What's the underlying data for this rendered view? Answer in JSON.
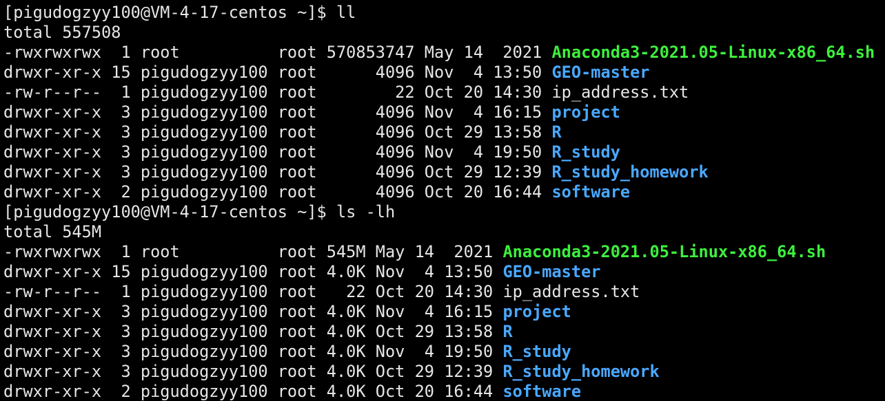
{
  "theme": {
    "background": "#000000",
    "text": "#e6e6e6",
    "executable": "#3df03d",
    "directory": "#4aa8ff"
  },
  "lines": [
    {
      "kind": "prompt",
      "prefix": "[pigudogzyy100@VM-4-17-centos ~]$ ll",
      "name": ""
    },
    {
      "kind": "output",
      "prefix": "total 557508",
      "name": ""
    },
    {
      "kind": "exec",
      "prefix": "-rwxrwxrwx  1 root          root 570853747 May 14  2021 ",
      "name": "Anaconda3-2021.05-Linux-x86_64.sh"
    },
    {
      "kind": "dir",
      "prefix": "drwxr-xr-x 15 pigudogzyy100 root      4096 Nov  4 13:50 ",
      "name": "GEO-master"
    },
    {
      "kind": "file",
      "prefix": "-rw-r--r--  1 pigudogzyy100 root        22 Oct 20 14:30 ",
      "name": "ip_address.txt"
    },
    {
      "kind": "dir",
      "prefix": "drwxr-xr-x  3 pigudogzyy100 root      4096 Nov  4 16:15 ",
      "name": "project"
    },
    {
      "kind": "dir",
      "prefix": "drwxr-xr-x  3 pigudogzyy100 root      4096 Oct 29 13:58 ",
      "name": "R"
    },
    {
      "kind": "dir",
      "prefix": "drwxr-xr-x  3 pigudogzyy100 root      4096 Nov  4 19:50 ",
      "name": "R_study"
    },
    {
      "kind": "dir",
      "prefix": "drwxr-xr-x  3 pigudogzyy100 root      4096 Oct 29 12:39 ",
      "name": "R_study_homework"
    },
    {
      "kind": "dir",
      "prefix": "drwxr-xr-x  2 pigudogzyy100 root      4096 Oct 20 16:44 ",
      "name": "software"
    },
    {
      "kind": "prompt",
      "prefix": "[pigudogzyy100@VM-4-17-centos ~]$ ls -lh",
      "name": ""
    },
    {
      "kind": "output",
      "prefix": "total 545M",
      "name": ""
    },
    {
      "kind": "exec",
      "prefix": "-rwxrwxrwx  1 root          root 545M May 14  2021 ",
      "name": "Anaconda3-2021.05-Linux-x86_64.sh"
    },
    {
      "kind": "dir",
      "prefix": "drwxr-xr-x 15 pigudogzyy100 root 4.0K Nov  4 13:50 ",
      "name": "GEO-master"
    },
    {
      "kind": "file",
      "prefix": "-rw-r--r--  1 pigudogzyy100 root   22 Oct 20 14:30 ",
      "name": "ip_address.txt"
    },
    {
      "kind": "dir",
      "prefix": "drwxr-xr-x  3 pigudogzyy100 root 4.0K Nov  4 16:15 ",
      "name": "project"
    },
    {
      "kind": "dir",
      "prefix": "drwxr-xr-x  3 pigudogzyy100 root 4.0K Oct 29 13:58 ",
      "name": "R"
    },
    {
      "kind": "dir",
      "prefix": "drwxr-xr-x  3 pigudogzyy100 root 4.0K Nov  4 19:50 ",
      "name": "R_study"
    },
    {
      "kind": "dir",
      "prefix": "drwxr-xr-x  3 pigudogzyy100 root 4.0K Oct 29 12:39 ",
      "name": "R_study_homework"
    },
    {
      "kind": "dir",
      "prefix": "drwxr-xr-x  2 pigudogzyy100 root 4.0K Oct 20 16:44 ",
      "name": "software"
    }
  ]
}
